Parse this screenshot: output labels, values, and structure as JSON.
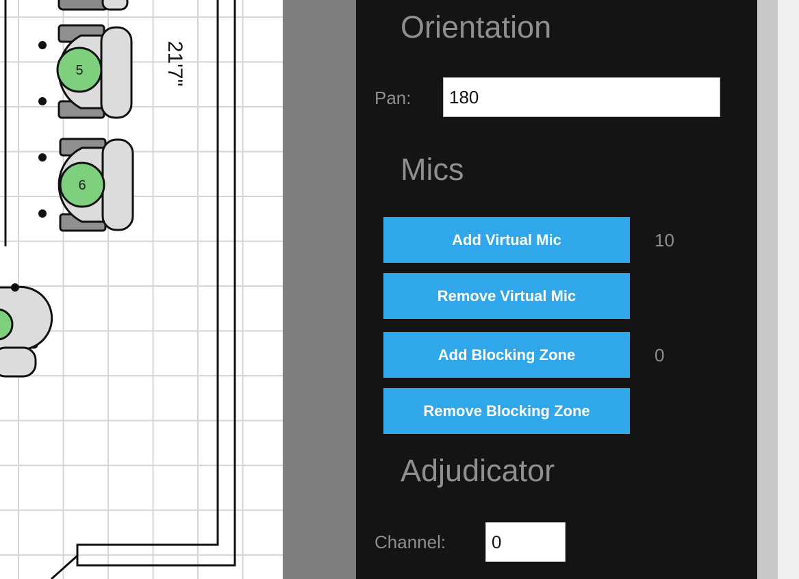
{
  "floorplan": {
    "seats": [
      {
        "number": "5"
      },
      {
        "number": "6"
      }
    ],
    "dimension_label": "21'7\""
  },
  "panel": {
    "orientation": {
      "title": "Orientation",
      "pan_label": "Pan:",
      "pan_value": "180"
    },
    "mics": {
      "title": "Mics",
      "add_virtual_mic_label": "Add Virtual Mic",
      "virtual_mic_count": "10",
      "remove_virtual_mic_label": "Remove Virtual Mic",
      "add_blocking_zone_label": "Add Blocking Zone",
      "blocking_zone_count": "0",
      "remove_blocking_zone_label": "Remove Blocking Zone"
    },
    "adjudicator": {
      "title": "Adjudicator",
      "channel_label": "Channel:",
      "channel_value": "0"
    }
  },
  "colors": {
    "panel_bg": "#141414",
    "button_bg": "#2fa7ea",
    "seat_marker": "#7ed07e",
    "label_gray": "#8f8f8f"
  },
  "icons": [
    "chair-icon",
    "seat-marker-icon"
  ]
}
